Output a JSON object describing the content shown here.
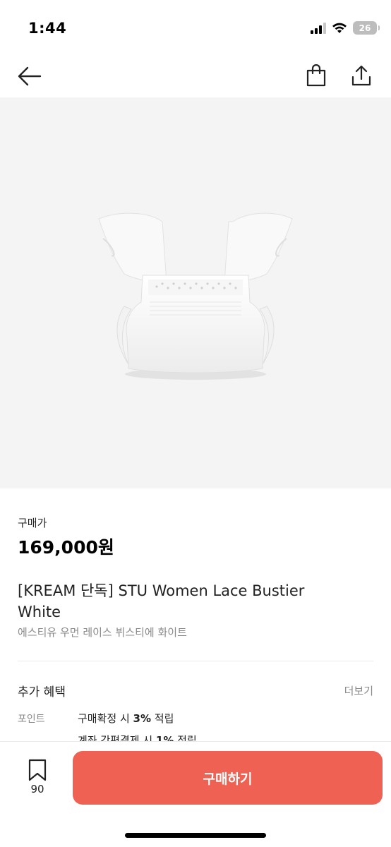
{
  "status_bar": {
    "time": "1:44",
    "battery": "26",
    "icons": [
      "cellular-signal-icon",
      "wifi-icon",
      "battery-icon"
    ]
  },
  "nav": {
    "icons": [
      "back-arrow-icon",
      "shopping-bag-icon",
      "share-icon"
    ]
  },
  "product": {
    "price_label": "구매가",
    "price": "169,000원",
    "name": "[KREAM 단독] STU Women Lace Bustier White",
    "subname": "에스티유 우먼 레이스 뷔스티에 화이트"
  },
  "benefits": {
    "title": "추가 혜택",
    "more": "더보기",
    "point_label": "포인트",
    "line1_prefix": "구매확정 시 ",
    "line1_value": "3%",
    "line1_suffix": " 적립",
    "line2_prefix": "계좌 간편결제 시 ",
    "line2_value": "1%",
    "line2_suffix": " 적립"
  },
  "bottom_bar": {
    "wish_count": "90",
    "buy_label": "구매하기"
  },
  "colors": {
    "accent": "#ef6253",
    "image_background": "#f4f4f4"
  }
}
